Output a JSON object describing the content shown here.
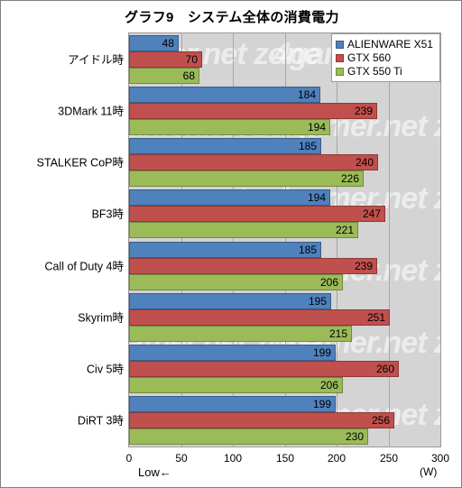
{
  "chart_data": {
    "type": "bar",
    "orientation": "horizontal",
    "title": "グラフ9　システム全体の消費電力",
    "xlabel": "(W)",
    "ylabel": "",
    "xlim": [
      0,
      300
    ],
    "xticks": [
      0,
      50,
      100,
      150,
      200,
      250,
      300
    ],
    "grid": true,
    "legend_position": "top-right",
    "annotation": "Low←",
    "unit": "(W)",
    "categories": [
      "アイドル時",
      "3DMark 11時",
      "STALKER CoP時",
      "BF3時",
      "Call of Duty 4時",
      "Skyrim時",
      "Civ 5時",
      "DiRT 3時"
    ],
    "series": [
      {
        "name": "ALIENWARE X51",
        "color": "#4f81bd",
        "values": [
          48,
          184,
          185,
          194,
          185,
          195,
          199,
          199
        ]
      },
      {
        "name": "GTX 560",
        "color": "#c0504d",
        "values": [
          70,
          239,
          240,
          247,
          239,
          251,
          260,
          256
        ]
      },
      {
        "name": "GTX 550 Ti",
        "color": "#9bbb59",
        "values": [
          68,
          194,
          226,
          221,
          206,
          215,
          206,
          230
        ]
      }
    ]
  },
  "watermark": {
    "text": "4gamer.net zone"
  }
}
